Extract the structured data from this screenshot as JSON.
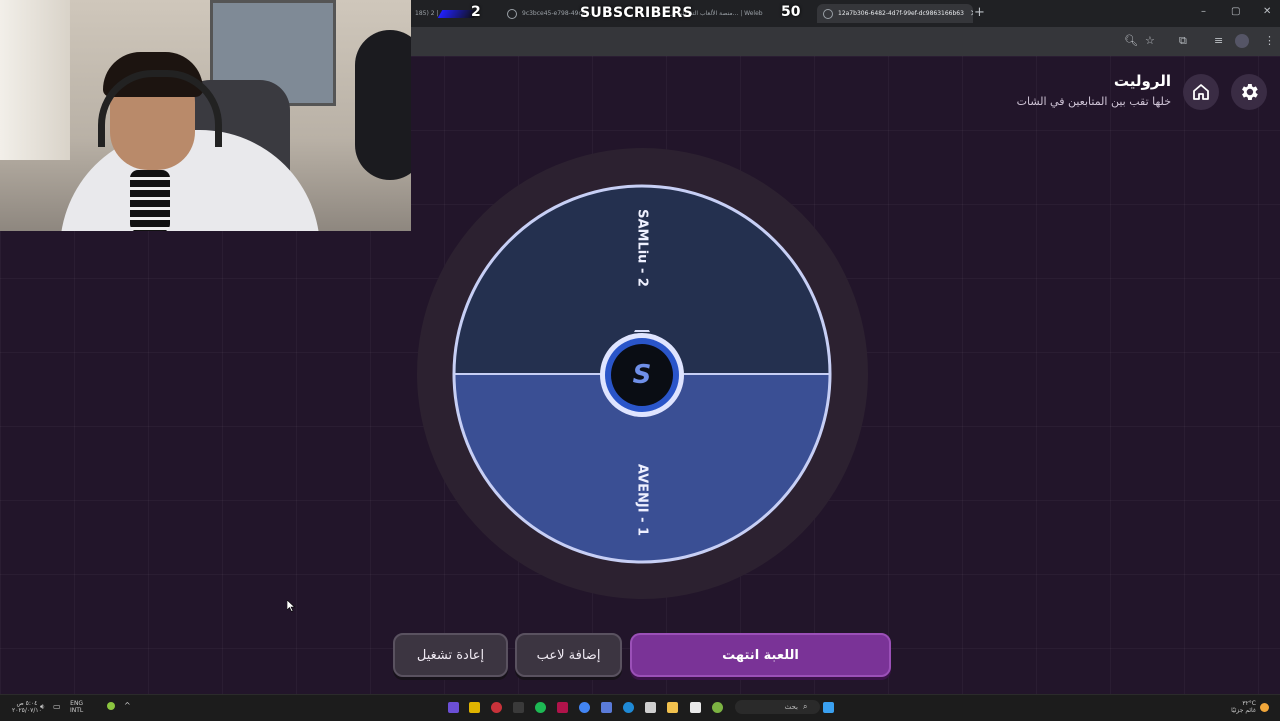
{
  "browser": {
    "tabs": [
      {
        "title": "بعد الشمال | 2 (185",
        "active": false
      },
      {
        "title": "9c3bce45-e798-49c4-...",
        "active": false
      },
      {
        "title": "منصة الألعاب التفاعلية لل... | Weleb",
        "active": false
      },
      {
        "title": "12a7b306-6482-4d7f-99ef-dc9863166b63",
        "active": true
      }
    ],
    "new_tab_label": "+",
    "window_controls": [
      "–",
      "▢",
      "✕"
    ]
  },
  "overlay": {
    "left_count": "2",
    "label": "SUBSCRIBERS",
    "right_count": "50"
  },
  "header": {
    "title": "الروليت",
    "subtitle": "خلها تقب بين المتابعين في الشات"
  },
  "wheel": {
    "segments": [
      {
        "label": "SAMLiu - 2",
        "color": "#24304f"
      },
      {
        "label": "AVENJI - 1",
        "color": "#3a4f94"
      }
    ],
    "rim_color": "#c7cff5",
    "hub_letter": "S"
  },
  "buttons": {
    "restart": "إعادة تشغيل",
    "add_player": "إضافة لاعب",
    "game_over": "اللعبة انتهت"
  },
  "taskbar": {
    "clock_time": "٥:٠٤ ص",
    "clock_date": "٢٠٢٥/٠٧/١٠",
    "lang_top": "ENG",
    "lang_bottom": "INTL",
    "search_placeholder": "بحث",
    "weather_temp": "٣٢°C",
    "weather_desc": "غائم جزئيًا"
  }
}
